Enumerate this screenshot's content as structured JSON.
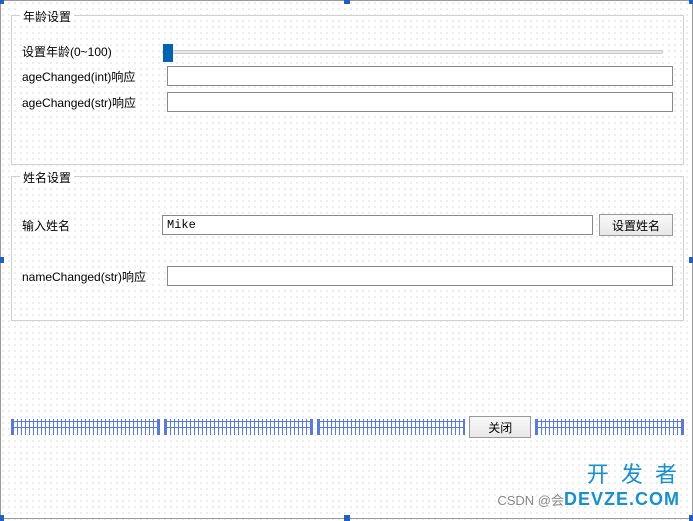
{
  "group_age": {
    "title": "年龄设置",
    "slider_label": "设置年龄(0~100)",
    "resp_int_label": "ageChanged(int)响应",
    "resp_int_value": "",
    "resp_str_label": "ageChanged(str)响应",
    "resp_str_value": ""
  },
  "group_name": {
    "title": "姓名设置",
    "input_label": "输入姓名",
    "input_value": "Mike",
    "set_button": "设置姓名",
    "resp_label": "nameChanged(str)响应",
    "resp_value": ""
  },
  "close_button": "关闭",
  "watermark": {
    "line1": "开 发 者",
    "line2_grey": "CSDN @会",
    "line2_blue": "DEVZE.COM"
  }
}
